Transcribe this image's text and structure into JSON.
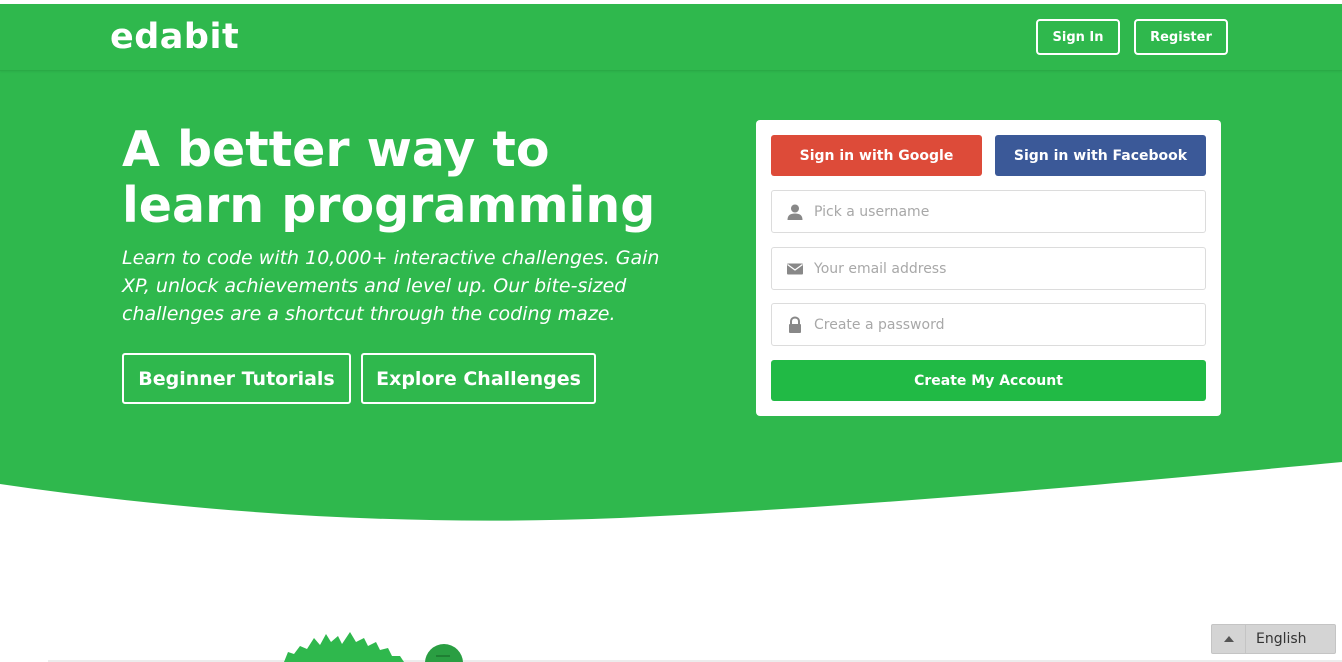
{
  "colors": {
    "brand_green": "#2fb84d",
    "create_button": "#21ba45",
    "google_red": "#dd4b39",
    "facebook_blue": "#3b5998",
    "white": "#ffffff"
  },
  "navbar": {
    "logo": "edabit",
    "signin_label": "Sign In",
    "register_label": "Register"
  },
  "hero": {
    "headline_line1": "A better way to",
    "headline_line2": "learn programming",
    "subtext": "Learn to code with 10,000+ interactive challenges. Gain XP, unlock achievements and level up. Our bite-sized challenges are a shortcut through the coding maze.",
    "tutorials_label": "Beginner Tutorials",
    "challenges_label": "Explore Challenges"
  },
  "signup": {
    "google_label": "Sign in with Google",
    "facebook_label": "Sign in with Facebook",
    "username_placeholder": "Pick a username",
    "email_placeholder": "Your email address",
    "password_placeholder": "Create a password",
    "create_label": "Create My Account",
    "icons": {
      "username": "user-icon",
      "email": "envelope-icon",
      "password": "lock-icon"
    }
  },
  "language": {
    "selected": "English",
    "arrow_icon": "caret-up-icon"
  }
}
